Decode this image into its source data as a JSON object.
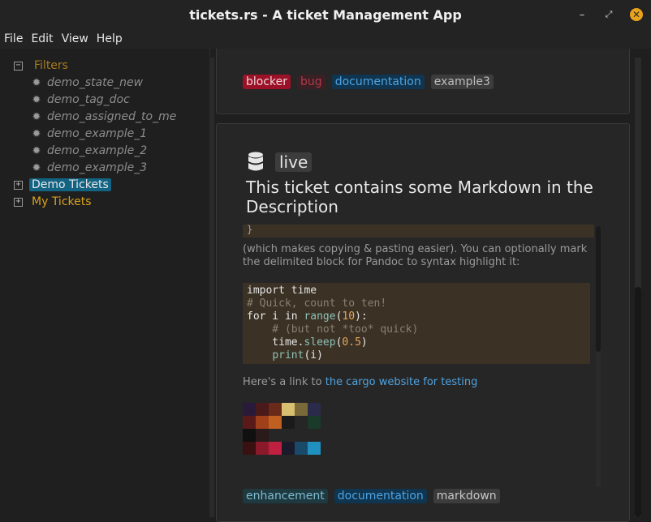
{
  "window": {
    "title": "tickets.rs - A ticket Management App",
    "buttons": {
      "minimize": "–",
      "maximize": "⤢",
      "close": "✕"
    }
  },
  "menu": {
    "items": [
      "File",
      "Edit",
      "View",
      "Help"
    ]
  },
  "sidebar": {
    "filters_label": "Filters",
    "filters_expander": "−",
    "queries": [
      "demo_state_new",
      "demo_tag_doc",
      "demo_assigned_to_me",
      "demo_example_1",
      "demo_example_2",
      "demo_example_3"
    ],
    "buckets": [
      {
        "label": "Demo Tickets",
        "selected": true,
        "expander": "+"
      },
      {
        "label": "My Tickets",
        "selected": false,
        "expander": "+"
      }
    ]
  },
  "ticket_prev": {
    "tags": [
      "blocker",
      "bug",
      "documentation",
      "example3"
    ]
  },
  "ticket": {
    "state": "live",
    "icon": "database-icon",
    "title": "This ticket contains some Markdown in the Description",
    "code_block_end": "}",
    "text1": "(which makes copying & pasting easier). You can optionally mark the delimited block for Pandoc to syntax highlight it:",
    "code": {
      "l1a": "import",
      "l1b": " time",
      "l2": "# Quick, count to ten!",
      "l3a": "for",
      "l3b": " i ",
      "l3c": "in",
      "l3d": " ",
      "l3e": "range",
      "l3f": "(",
      "l3g": "10",
      "l3h": "):",
      "l4": "    # (but not *too* quick)",
      "l5a": "    time.",
      "l5b": "sleep",
      "l5c": "(",
      "l5d": "0.5",
      "l5e": ")",
      "l6a": "    ",
      "l6b": "print",
      "l6c": "(i)"
    },
    "link_prefix": "Here's a link to ",
    "link_text": "the cargo website for testing",
    "tags": [
      "enhancement",
      "documentation",
      "markdown"
    ]
  },
  "colors": {
    "accent": "#136383",
    "filter_label": "#a87b1e",
    "my_tickets_label": "#d9a21f",
    "link": "#4fa3e0",
    "tag_blocker": "#9b1228"
  }
}
